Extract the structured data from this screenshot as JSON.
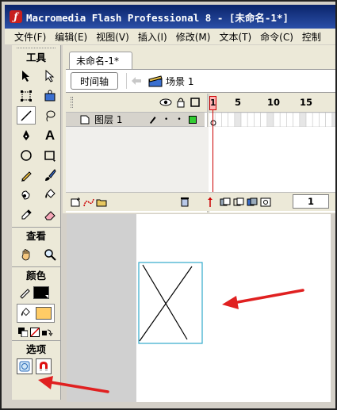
{
  "window": {
    "title": "Macromedia Flash Professional 8 - [未命名-1*]"
  },
  "menu": [
    "文件(F)",
    "编辑(E)",
    "视图(V)",
    "插入(I)",
    "修改(M)",
    "文本(T)",
    "命令(C)",
    "控制"
  ],
  "tools": {
    "header": "工具",
    "view_label": "查看",
    "colors_label": "颜色",
    "options_label": "选项",
    "items": [
      "selection-arrow-icon",
      "subselection-arrow-icon",
      "free-transform-icon",
      "fill-transform-icon",
      "line-icon",
      "lasso-icon",
      "pen-icon",
      "text-icon",
      "oval-icon",
      "rectangle-icon",
      "pencil-icon",
      "brush-icon",
      "ink-bottle-icon",
      "paint-bucket-icon",
      "eyedropper-icon",
      "eraser-icon"
    ],
    "view_items": [
      "hand-icon",
      "zoom-icon"
    ],
    "stroke_color": "#000000",
    "fill_color": "#ffcc66",
    "options": [
      "object-drawing-icon",
      "snap-magnet-icon"
    ]
  },
  "document": {
    "tab_label": "未命名-1*",
    "timeline_button": "时间轴",
    "scene_label": "场景 1"
  },
  "timeline": {
    "frame_labels": [
      "1",
      "5",
      "10",
      "15"
    ],
    "layer_name": "图层 1",
    "current_frame": "1"
  },
  "colors": {
    "title_bar": "#0a246a",
    "playhead": "#cc0000",
    "annotation_arrow": "#e02020",
    "rect_outline": "#33aacc"
  }
}
